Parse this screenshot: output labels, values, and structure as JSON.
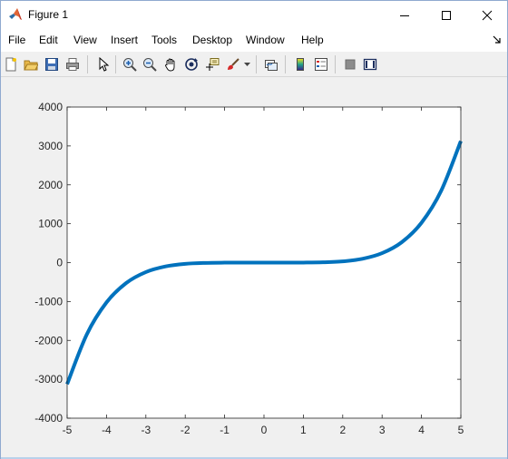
{
  "window": {
    "title": "Figure 1",
    "icons": {
      "app": "matlab-logo-icon",
      "minimize": "minimize-icon",
      "maximize": "maximize-icon",
      "close": "close-icon"
    }
  },
  "menubar": {
    "items": [
      "File",
      "Edit",
      "View",
      "Insert",
      "Tools",
      "Desktop",
      "Window",
      "Help"
    ],
    "overflow_icon": "dock-arrow-icon"
  },
  "toolbar": {
    "buttons": [
      "new-figure-icon",
      "open-file-icon",
      "save-icon",
      "print-icon",
      "edit-plot-pointer-icon",
      "zoom-in-icon",
      "zoom-out-icon",
      "pan-hand-icon",
      "rotate-3d-icon",
      "data-cursor-icon",
      "brush-icon",
      "link-plot-icon",
      "colorbar-icon",
      "legend-icon",
      "hide-plot-tools-icon",
      "show-plot-tools-icon"
    ]
  },
  "colors": {
    "line": "#0072bd",
    "axes_bg": "#ffffff",
    "figure_bg": "#f0f0f0",
    "axis_color": "#262626"
  },
  "chart_data": {
    "type": "line",
    "title": "",
    "xlabel": "",
    "ylabel": "",
    "xlim": [
      -5,
      5
    ],
    "ylim": [
      -4000,
      4000
    ],
    "xticks": [
      -5,
      -4,
      -3,
      -2,
      -1,
      0,
      1,
      2,
      3,
      4,
      5
    ],
    "yticks": [
      -4000,
      -3000,
      -2000,
      -1000,
      0,
      1000,
      2000,
      3000,
      4000
    ],
    "grid": false,
    "legend": "none",
    "series": [
      {
        "x": [
          -5,
          -4.5,
          -4,
          -3.5,
          -3,
          -2.5,
          -2,
          -1.5,
          -1,
          -0.5,
          0,
          0.5,
          1,
          1.5,
          2,
          2.5,
          3,
          3.5,
          4,
          4.5,
          5
        ],
        "y": [
          -3125,
          -1845,
          -1024,
          -525,
          -243,
          -98,
          -32,
          -8,
          -1,
          0,
          0,
          0,
          1,
          8,
          32,
          98,
          243,
          525,
          1024,
          1845,
          3125
        ]
      }
    ]
  }
}
